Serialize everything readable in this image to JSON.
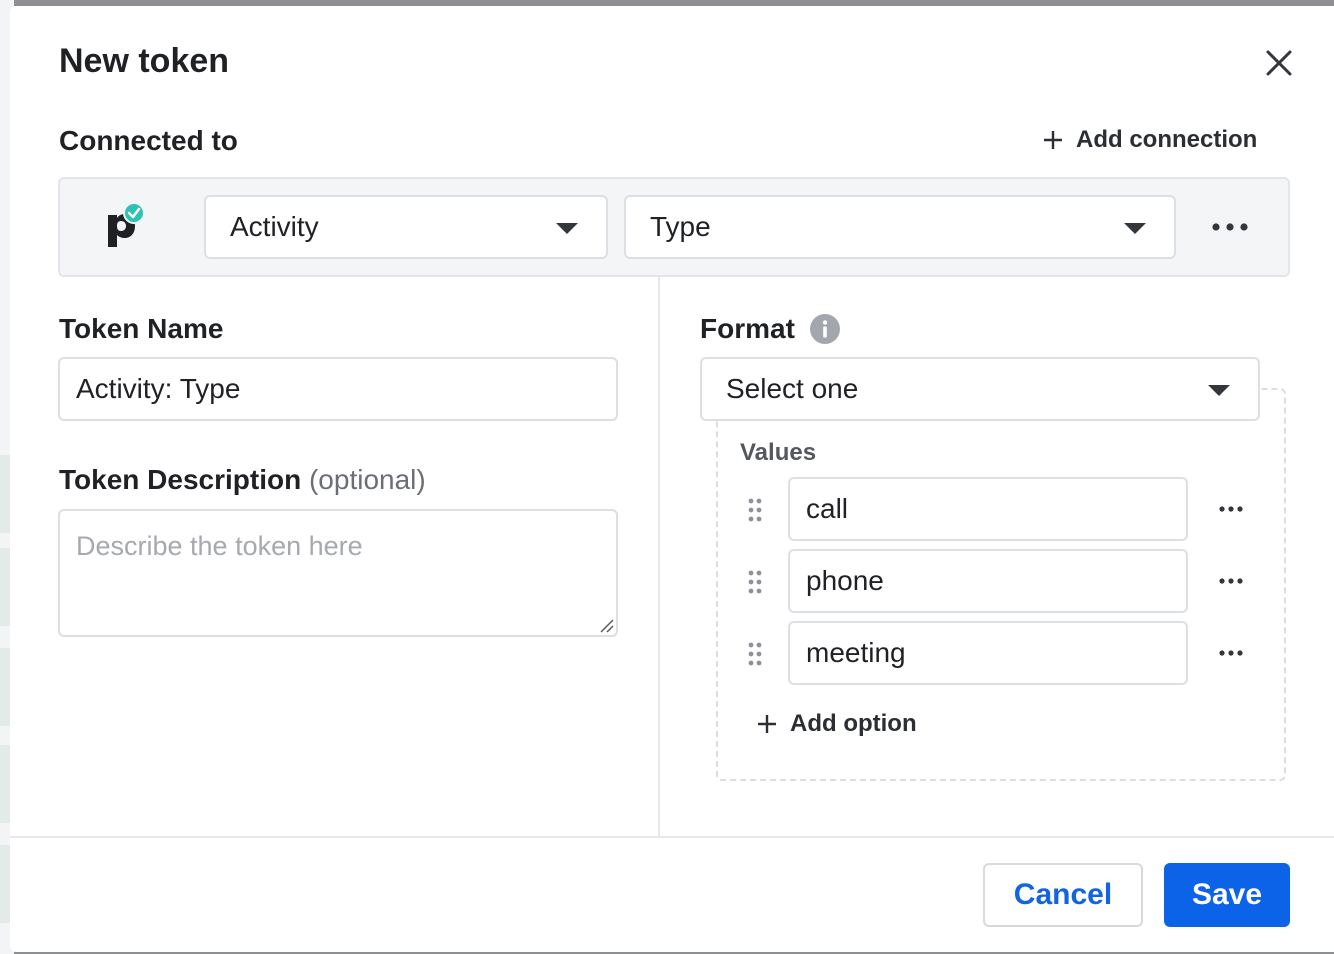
{
  "modal": {
    "title": "New token",
    "close_icon": "close-icon"
  },
  "connection": {
    "label": "Connected to",
    "add_connection_label": "Add connection",
    "logo_icon": "pipedrive-logo-icon",
    "object_select_value": "Activity",
    "field_select_value": "Type",
    "more_icon": "more-horizontal-icon"
  },
  "token_name": {
    "label": "Token Name",
    "value": "Activity: Type"
  },
  "token_description": {
    "label": "Token Description",
    "optional_label": "(optional)",
    "placeholder": "Describe the token here",
    "value": ""
  },
  "format": {
    "label": "Format",
    "info_icon": "info-icon",
    "select_value": "Select one",
    "values_label": "Values",
    "values": [
      "call",
      "phone",
      "meeting"
    ],
    "add_option_label": "Add option"
  },
  "footer": {
    "cancel_label": "Cancel",
    "save_label": "Save"
  },
  "colors": {
    "primary": "#0d63e8",
    "logo_badge": "#2dc2b3",
    "text": "#1f2124",
    "border": "#dcdfe3"
  }
}
